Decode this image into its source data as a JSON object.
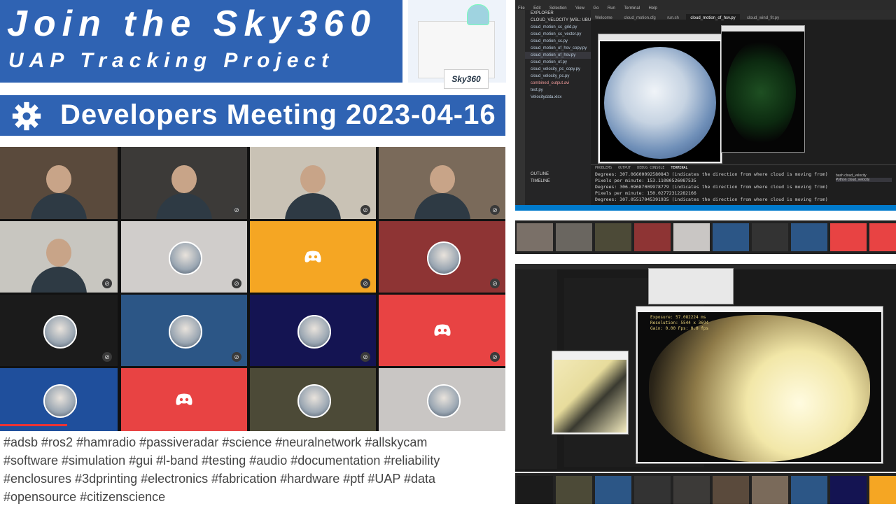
{
  "banner": {
    "title_line1": "Join the Sky360",
    "title_line2": "UAP Tracking Project",
    "product_label": "Sky360"
  },
  "meeting": {
    "title": "Developers Meeting 2023-04-16"
  },
  "tiles": [
    {
      "kind": "video",
      "name": "participant-1",
      "color": "#5a4a3c"
    },
    {
      "kind": "video",
      "name": "participant-2",
      "color": "#3c3a38"
    },
    {
      "kind": "video",
      "name": "participant-3",
      "color": "#c9c2b5"
    },
    {
      "kind": "video",
      "name": "participant-4",
      "color": "#7a6a5a"
    },
    {
      "kind": "video",
      "name": "participant-5",
      "color": "#c8c6c0"
    },
    {
      "kind": "avatar",
      "name": "palm-avatar",
      "color": "#d0cdcb"
    },
    {
      "kind": "discord",
      "name": "discord-yellow",
      "color": "#f5a623"
    },
    {
      "kind": "avatar",
      "name": "woman-avatar",
      "color": "#8e3434"
    },
    {
      "kind": "avatar",
      "name": "man-avatar",
      "color": "#1b1b1b"
    },
    {
      "kind": "avatar",
      "name": "sky-avatar",
      "color": "#2c5686"
    },
    {
      "kind": "avatar",
      "name": "purple-avatar",
      "color": "#141452"
    },
    {
      "kind": "discord",
      "name": "discord-red",
      "color": "#e84343"
    },
    {
      "kind": "avatar",
      "name": "sky360-avatar",
      "color": "#1f4f9c"
    },
    {
      "kind": "discord",
      "name": "discord-red-2",
      "color": "#e84343"
    },
    {
      "kind": "avatar",
      "name": "helmet-avatar",
      "color": "#4c4a37"
    },
    {
      "kind": "avatar",
      "name": "santa-avatar",
      "color": "#c9c6c4"
    }
  ],
  "hashtags": [
    "#adsb #ros2 #hamradio #passiveradar #science #neuralnetwork #allskycam",
    "#software #simulation #gui #l-band #testing #audio #documentation #reliability",
    "#enclosures #3dprinting #electronics  #fabrication #hardware #ptf #UAP #data",
    "#opensource #citizenscience"
  ],
  "ide": {
    "menu": [
      "File",
      "Edit",
      "Selection",
      "View",
      "Go",
      "Run",
      "Terminal",
      "Help"
    ],
    "explorer_title": "EXPLORER",
    "files": [
      "CLOUD_VELOCITY [WSL: UBUNTU]",
      "cloud_motion_cc_grid.py",
      "cloud_motion_cc_vector.py",
      "cloud_motion_cc.py",
      "cloud_motion_of_hsv_copy.py",
      "cloud_motion_of_hsv.py",
      "cloud_motion_of.py",
      "cloud_velocity_pc_copy.py",
      "cloud_velocity_pc.py",
      "combined_output.avi",
      "test.py",
      "Velocitydata.xlsx"
    ],
    "outline_label": "OUTLINE",
    "timeline_label": "TIMELINE",
    "tabs": [
      "Welcome",
      "cloud_motion.cfg",
      "run.sh",
      "cloud_motion_of_hsv.py",
      "cloud_wind_fit.py"
    ],
    "panel_tabs": [
      "PROBLEMS",
      "OUTPUT",
      "DEBUG CONSOLE",
      "TERMINAL"
    ],
    "terminal": [
      "Degrees: 307.06600092580843  (indicates the direction from where cloud is moving from)",
      "Pixels per minute: 153.11080526087535",
      "Degrees: 306.69687009978779  (indicates the direction from where cloud is moving from)",
      "Pixels per minute: 150.02772312282166",
      "Degrees: 307.05517045391935  (indicates the direction from where cloud is moving from)"
    ],
    "status_left": "WSL: Ubuntu",
    "status_right": "Ln 45, Col 28   Spaces: 4   UTF-8   Python   3.10.6 64-bit",
    "shells": [
      "bash cloud_velocity",
      "Python cloud_velocity"
    ]
  },
  "desk2": {
    "overlay_lines": [
      "Exposure: 57.082224 ms",
      "Resolution: 5544 x 3694",
      "Gain: 0.00  Fps: 0.0 fps"
    ]
  }
}
